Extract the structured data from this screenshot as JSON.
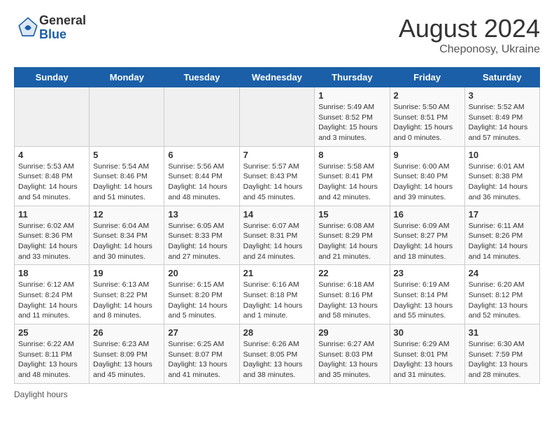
{
  "header": {
    "logo_general": "General",
    "logo_blue": "Blue",
    "month_year": "August 2024",
    "location": "Cheponosy, Ukraine"
  },
  "days_of_week": [
    "Sunday",
    "Monday",
    "Tuesday",
    "Wednesday",
    "Thursday",
    "Friday",
    "Saturday"
  ],
  "footer": {
    "daylight_hours_label": "Daylight hours"
  },
  "weeks": [
    [
      {
        "day": "",
        "info": ""
      },
      {
        "day": "",
        "info": ""
      },
      {
        "day": "",
        "info": ""
      },
      {
        "day": "",
        "info": ""
      },
      {
        "day": "1",
        "info": "Sunrise: 5:49 AM\nSunset: 8:52 PM\nDaylight: 15 hours\nand 3 minutes."
      },
      {
        "day": "2",
        "info": "Sunrise: 5:50 AM\nSunset: 8:51 PM\nDaylight: 15 hours\nand 0 minutes."
      },
      {
        "day": "3",
        "info": "Sunrise: 5:52 AM\nSunset: 8:49 PM\nDaylight: 14 hours\nand 57 minutes."
      }
    ],
    [
      {
        "day": "4",
        "info": "Sunrise: 5:53 AM\nSunset: 8:48 PM\nDaylight: 14 hours\nand 54 minutes."
      },
      {
        "day": "5",
        "info": "Sunrise: 5:54 AM\nSunset: 8:46 PM\nDaylight: 14 hours\nand 51 minutes."
      },
      {
        "day": "6",
        "info": "Sunrise: 5:56 AM\nSunset: 8:44 PM\nDaylight: 14 hours\nand 48 minutes."
      },
      {
        "day": "7",
        "info": "Sunrise: 5:57 AM\nSunset: 8:43 PM\nDaylight: 14 hours\nand 45 minutes."
      },
      {
        "day": "8",
        "info": "Sunrise: 5:58 AM\nSunset: 8:41 PM\nDaylight: 14 hours\nand 42 minutes."
      },
      {
        "day": "9",
        "info": "Sunrise: 6:00 AM\nSunset: 8:40 PM\nDaylight: 14 hours\nand 39 minutes."
      },
      {
        "day": "10",
        "info": "Sunrise: 6:01 AM\nSunset: 8:38 PM\nDaylight: 14 hours\nand 36 minutes."
      }
    ],
    [
      {
        "day": "11",
        "info": "Sunrise: 6:02 AM\nSunset: 8:36 PM\nDaylight: 14 hours\nand 33 minutes."
      },
      {
        "day": "12",
        "info": "Sunrise: 6:04 AM\nSunset: 8:34 PM\nDaylight: 14 hours\nand 30 minutes."
      },
      {
        "day": "13",
        "info": "Sunrise: 6:05 AM\nSunset: 8:33 PM\nDaylight: 14 hours\nand 27 minutes."
      },
      {
        "day": "14",
        "info": "Sunrise: 6:07 AM\nSunset: 8:31 PM\nDaylight: 14 hours\nand 24 minutes."
      },
      {
        "day": "15",
        "info": "Sunrise: 6:08 AM\nSunset: 8:29 PM\nDaylight: 14 hours\nand 21 minutes."
      },
      {
        "day": "16",
        "info": "Sunrise: 6:09 AM\nSunset: 8:27 PM\nDaylight: 14 hours\nand 18 minutes."
      },
      {
        "day": "17",
        "info": "Sunrise: 6:11 AM\nSunset: 8:26 PM\nDaylight: 14 hours\nand 14 minutes."
      }
    ],
    [
      {
        "day": "18",
        "info": "Sunrise: 6:12 AM\nSunset: 8:24 PM\nDaylight: 14 hours\nand 11 minutes."
      },
      {
        "day": "19",
        "info": "Sunrise: 6:13 AM\nSunset: 8:22 PM\nDaylight: 14 hours\nand 8 minutes."
      },
      {
        "day": "20",
        "info": "Sunrise: 6:15 AM\nSunset: 8:20 PM\nDaylight: 14 hours\nand 5 minutes."
      },
      {
        "day": "21",
        "info": "Sunrise: 6:16 AM\nSunset: 8:18 PM\nDaylight: 14 hours\nand 1 minute."
      },
      {
        "day": "22",
        "info": "Sunrise: 6:18 AM\nSunset: 8:16 PM\nDaylight: 13 hours\nand 58 minutes."
      },
      {
        "day": "23",
        "info": "Sunrise: 6:19 AM\nSunset: 8:14 PM\nDaylight: 13 hours\nand 55 minutes."
      },
      {
        "day": "24",
        "info": "Sunrise: 6:20 AM\nSunset: 8:12 PM\nDaylight: 13 hours\nand 52 minutes."
      }
    ],
    [
      {
        "day": "25",
        "info": "Sunrise: 6:22 AM\nSunset: 8:11 PM\nDaylight: 13 hours\nand 48 minutes."
      },
      {
        "day": "26",
        "info": "Sunrise: 6:23 AM\nSunset: 8:09 PM\nDaylight: 13 hours\nand 45 minutes."
      },
      {
        "day": "27",
        "info": "Sunrise: 6:25 AM\nSunset: 8:07 PM\nDaylight: 13 hours\nand 41 minutes."
      },
      {
        "day": "28",
        "info": "Sunrise: 6:26 AM\nSunset: 8:05 PM\nDaylight: 13 hours\nand 38 minutes."
      },
      {
        "day": "29",
        "info": "Sunrise: 6:27 AM\nSunset: 8:03 PM\nDaylight: 13 hours\nand 35 minutes."
      },
      {
        "day": "30",
        "info": "Sunrise: 6:29 AM\nSunset: 8:01 PM\nDaylight: 13 hours\nand 31 minutes."
      },
      {
        "day": "31",
        "info": "Sunrise: 6:30 AM\nSunset: 7:59 PM\nDaylight: 13 hours\nand 28 minutes."
      }
    ]
  ]
}
